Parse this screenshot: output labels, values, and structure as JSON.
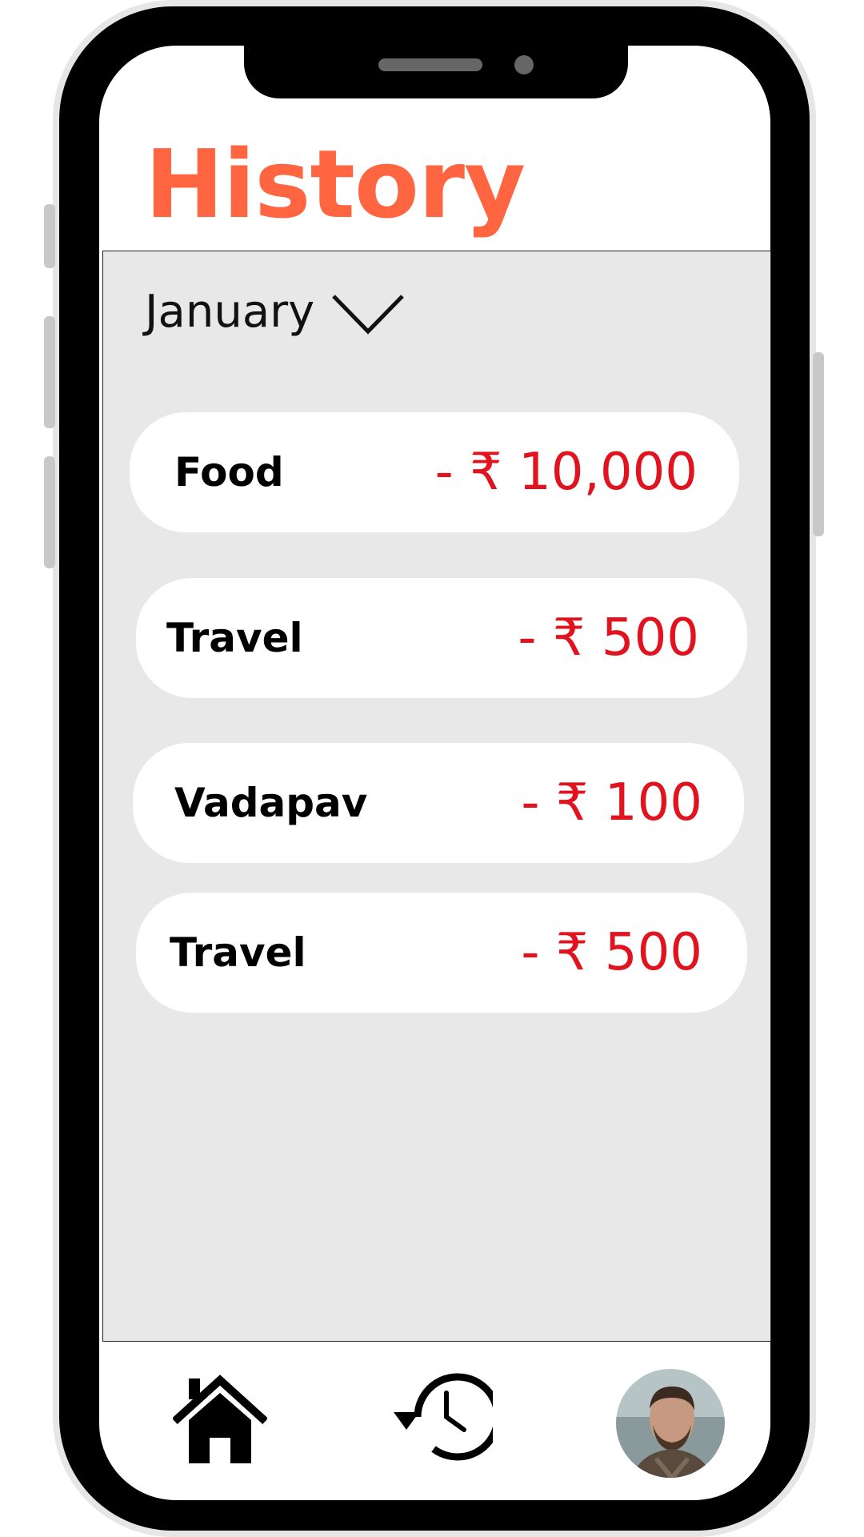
{
  "header": {
    "title": "History"
  },
  "filter": {
    "month": "January",
    "dropdown_icon": "chevron-down-icon"
  },
  "expenses": [
    {
      "name": "Food",
      "amount": "- ₹ 10,000"
    },
    {
      "name": "Travel",
      "amount": "- ₹ 500"
    },
    {
      "name": "Vadapav",
      "amount": "- ₹ 100"
    },
    {
      "name": "Travel",
      "amount": "- ₹ 500"
    }
  ],
  "bottom_nav": {
    "items": [
      {
        "icon": "home-icon"
      },
      {
        "icon": "history-icon"
      },
      {
        "icon": "avatar"
      }
    ]
  },
  "colors": {
    "title": "#ff6541",
    "amount": "#e0131f",
    "panel": "#e8e8e8",
    "card": "#ffffff",
    "frame": "#000000"
  }
}
